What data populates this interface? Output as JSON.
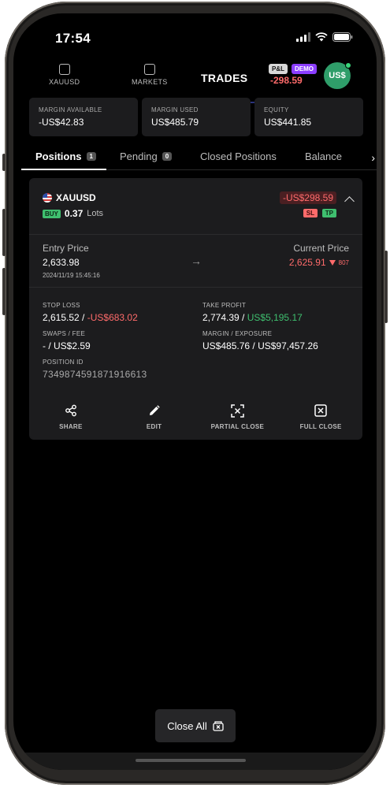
{
  "status_bar": {
    "time": "17:54"
  },
  "nav": {
    "tabs": [
      {
        "label": "XAUUSD",
        "icon": "chart-icon"
      },
      {
        "label": "MARKETS",
        "icon": "markets-icon"
      }
    ],
    "title": "TRADES",
    "pl_badge": "P&L",
    "demo_badge": "DEMO",
    "pl_value": "-298.59",
    "avatar_text": "US$"
  },
  "summary": [
    {
      "label": "MARGIN AVAILABLE",
      "value": "-US$42.83"
    },
    {
      "label": "MARGIN USED",
      "value": "US$485.79"
    },
    {
      "label": "EQUITY",
      "value": "US$441.85"
    }
  ],
  "subtabs": {
    "positions": "Positions",
    "positions_count": "1",
    "pending": "Pending",
    "pending_count": "0",
    "closed": "Closed Positions",
    "balance": "Balance"
  },
  "position": {
    "symbol": "XAUUSD",
    "side": "BUY",
    "lots": "0.37",
    "lots_label": "Lots",
    "pnl": "-US$298.59",
    "sl_badge": "SL",
    "tp_badge": "TP",
    "entry_label": "Entry Price",
    "entry_price": "2,633.98",
    "entry_time": "2024/11/19 15:45:16",
    "current_label": "Current Price",
    "current_price": "2,625.91",
    "current_points": "807",
    "stop_loss_label": "STOP LOSS",
    "stop_loss_price": "2,615.52",
    "stop_loss_amount": "-US$683.02",
    "take_profit_label": "TAKE PROFIT",
    "take_profit_price": "2,774.39",
    "take_profit_amount": "US$5,195.17",
    "swaps_label": "SWAPS / FEE",
    "swaps_value": "-",
    "fee_value": "US$2.59",
    "margin_label": "MARGIN / EXPOSURE",
    "margin_value": "US$485.76",
    "exposure_value": "US$97,457.26",
    "position_id_label": "POSITION ID",
    "position_id": "7349874591871916613",
    "actions": {
      "share": "SHARE",
      "edit": "EDIT",
      "partial_close": "PARTIAL CLOSE",
      "full_close": "FULL CLOSE"
    }
  },
  "close_all_label": "Close All",
  "colors": {
    "negative": "#ff6b6b",
    "positive": "#3fbf6f",
    "avatar": "#2f9e6a",
    "demo": "#8b3dff"
  }
}
